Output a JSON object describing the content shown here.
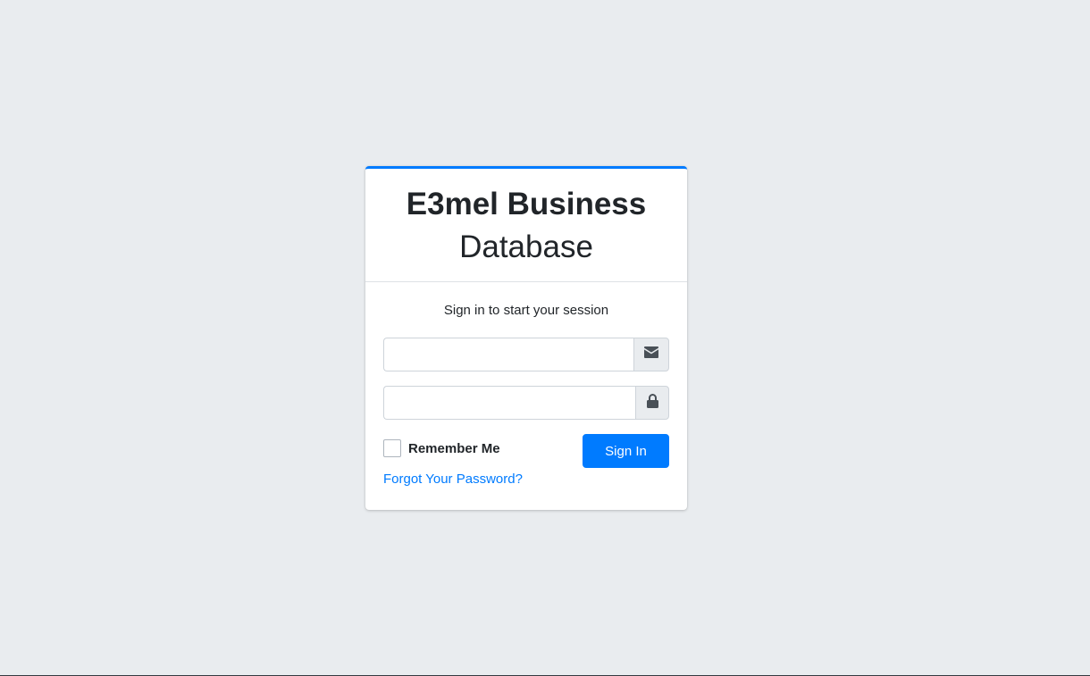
{
  "brand": {
    "bold": "E3mel Business",
    "light": "Database"
  },
  "login": {
    "message": "Sign in to start your session",
    "email_value": "",
    "password_value": "",
    "remember_label": "Remember Me",
    "signin_label": "Sign In",
    "forgot_label": "Forgot Your Password?"
  },
  "icons": {
    "email": "envelope-icon",
    "password": "lock-icon"
  },
  "colors": {
    "accent": "#007bff",
    "background": "#e9ecef",
    "addon": "#e9ecef",
    "icon": "#495057"
  }
}
